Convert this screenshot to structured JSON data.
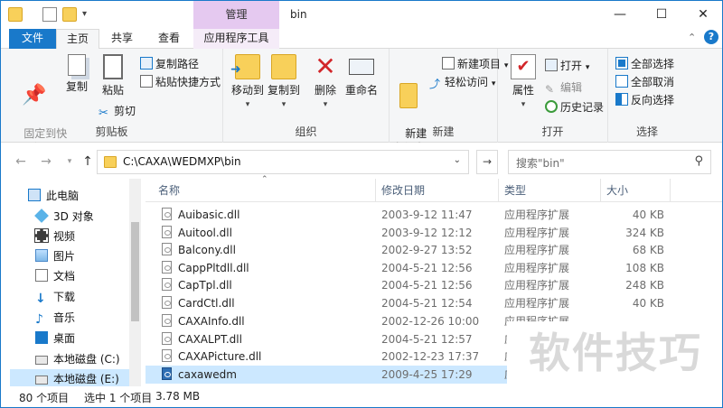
{
  "window": {
    "title": "bin",
    "context_tab_group": "管理",
    "controls": [
      "—",
      "☐",
      "✕"
    ]
  },
  "tabs": [
    {
      "label": "文件"
    },
    {
      "label": "主页"
    },
    {
      "label": "共享"
    },
    {
      "label": "查看"
    },
    {
      "label": "应用程序工具"
    }
  ],
  "ribbon": {
    "clipboard": {
      "pin": "固定到快\n速访问",
      "copy": "复制",
      "paste": "粘贴",
      "copy_path": "复制路径",
      "paste_shortcut": "粘贴快捷方式",
      "cut": "剪切",
      "label": "剪贴板"
    },
    "organize": {
      "move_to": "移动到",
      "copy_to": "复制到",
      "delete": "删除",
      "rename": "重命名",
      "label": "组织"
    },
    "new": {
      "new_folder": "新建\n文件夹",
      "new_item": "新建项目",
      "easy_access": "轻松访问",
      "label": "新建"
    },
    "open": {
      "properties": "属性",
      "open": "打开",
      "edit": "编辑",
      "history": "历史记录",
      "label": "打开"
    },
    "select": {
      "select_all": "全部选择",
      "select_none": "全部取消",
      "invert": "反向选择",
      "label": "选择"
    }
  },
  "address": {
    "path": "C:\\CAXA\\WEDMXP\\bin",
    "search_placeholder": "搜索\"bin\""
  },
  "nav_pane": [
    {
      "label": "此电脑",
      "icon": "pc-icon"
    },
    {
      "label": "3D 对象",
      "icon": "cube-icon"
    },
    {
      "label": "视频",
      "icon": "video-icon"
    },
    {
      "label": "图片",
      "icon": "picture-icon"
    },
    {
      "label": "文档",
      "icon": "document-icon"
    },
    {
      "label": "下载",
      "icon": "download-icon"
    },
    {
      "label": "音乐",
      "icon": "music-icon"
    },
    {
      "label": "桌面",
      "icon": "desktop-icon"
    },
    {
      "label": "本地磁盘 (C:)",
      "icon": "drive-icon"
    },
    {
      "label": "本地磁盘 (E:)",
      "icon": "drive-icon"
    }
  ],
  "columns": {
    "name": "名称",
    "date": "修改日期",
    "type": "类型",
    "size": "大小"
  },
  "files": [
    {
      "name": "Auibasic.dll",
      "date": "2003-9-12 11:47",
      "type": "应用程序扩展",
      "size": "40 KB"
    },
    {
      "name": "Auitool.dll",
      "date": "2003-9-12 12:12",
      "type": "应用程序扩展",
      "size": "324 KB"
    },
    {
      "name": "Balcony.dll",
      "date": "2002-9-27 13:52",
      "type": "应用程序扩展",
      "size": "68 KB"
    },
    {
      "name": "CappPltdll.dll",
      "date": "2004-5-21 12:56",
      "type": "应用程序扩展",
      "size": "108 KB"
    },
    {
      "name": "CapTpl.dll",
      "date": "2004-5-21 12:56",
      "type": "应用程序扩展",
      "size": "248 KB"
    },
    {
      "name": "CardCtl.dll",
      "date": "2004-5-21 12:54",
      "type": "应用程序扩展",
      "size": "40 KB"
    },
    {
      "name": "CAXAInfo.dll",
      "date": "2002-12-26 10:00",
      "type": "应用程序扩展",
      "size": ""
    },
    {
      "name": "CAXALPT.dll",
      "date": "2004-5-21 12:57",
      "type": "应用程序扩展",
      "size": ""
    },
    {
      "name": "CAXAPicture.dll",
      "date": "2002-12-23 17:37",
      "type": "应用程序扩展",
      "size": ""
    },
    {
      "name": "caxawedm",
      "date": "2009-4-25 17:29",
      "type": "应用程序",
      "size": ""
    }
  ],
  "status": {
    "count": "80 个项目",
    "selected": "选中 1 个项目",
    "size": "3.78 MB"
  },
  "watermark": "软件技巧"
}
